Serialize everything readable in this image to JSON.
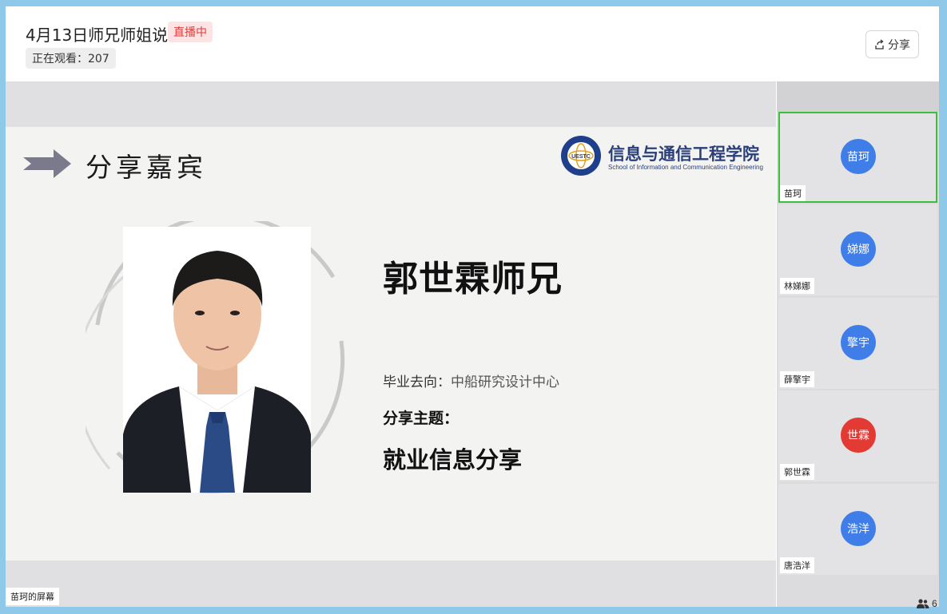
{
  "header": {
    "title": "4月13日师兄师姐说",
    "live_badge": "直播中",
    "viewers": "正在观看：207",
    "share_label": "分享"
  },
  "slide": {
    "title": "分享嘉宾",
    "institution_name": "信息与通信工程学院",
    "institution_en": "School of Information and Communication Engineering",
    "logo_text": "UESTC",
    "guest_name": "郭世霖师兄",
    "destination_label": "毕业去向：",
    "destination_value": "中船研究设计中心",
    "topic_label": "分享主题：",
    "topic": "就业信息分享"
  },
  "screen_share_label": "苗珂的屏幕",
  "participants": [
    {
      "avatar_text": "苗珂",
      "name": "苗珂",
      "color": "#3f7de8",
      "active": true
    },
    {
      "avatar_text": "娣娜",
      "name": "林娣娜",
      "color": "#3f7de8",
      "active": false
    },
    {
      "avatar_text": "擎宇",
      "name": "薛擎宇",
      "color": "#3f7de8",
      "active": false
    },
    {
      "avatar_text": "世霖",
      "name": "郭世霖",
      "color": "#e33b34",
      "active": false
    },
    {
      "avatar_text": "浩洋",
      "name": "唐浩洋",
      "color": "#3f7de8",
      "active": false
    }
  ],
  "participant_count": "6",
  "icons": {
    "share": "share-icon",
    "people": "people-icon",
    "arrow": "arrow-right-icon"
  }
}
